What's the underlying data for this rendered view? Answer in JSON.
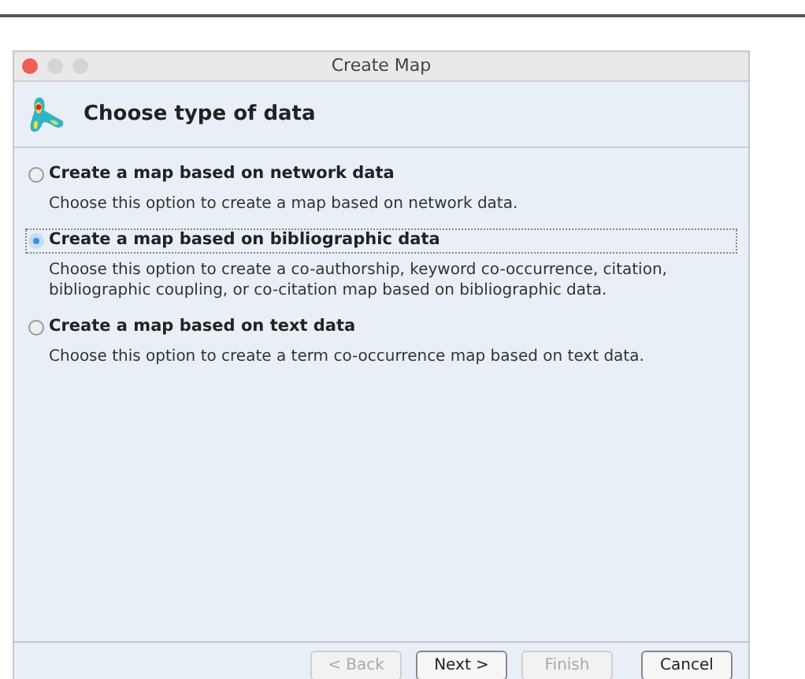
{
  "window": {
    "title": "Create Map"
  },
  "header": {
    "title": "Choose type of data"
  },
  "options": [
    {
      "label": "Create a map based on network data",
      "description": "Choose this option to create a map based on network data.",
      "selected": false
    },
    {
      "label": "Create a map based on bibliographic data",
      "description": "Choose this option to create a co-authorship, keyword co-occurrence, citation, bibliographic coupling, or co-citation map based on bibliographic data.",
      "selected": true
    },
    {
      "label": "Create a map based on text data",
      "description": "Choose this option to create a term co-occurrence map based on text data.",
      "selected": false
    }
  ],
  "buttons": [
    {
      "label": "< Back",
      "disabled": true
    },
    {
      "label": "Next >",
      "disabled": false
    },
    {
      "label": "Finish",
      "disabled": true
    },
    {
      "label": "Cancel",
      "disabled": false
    }
  ]
}
